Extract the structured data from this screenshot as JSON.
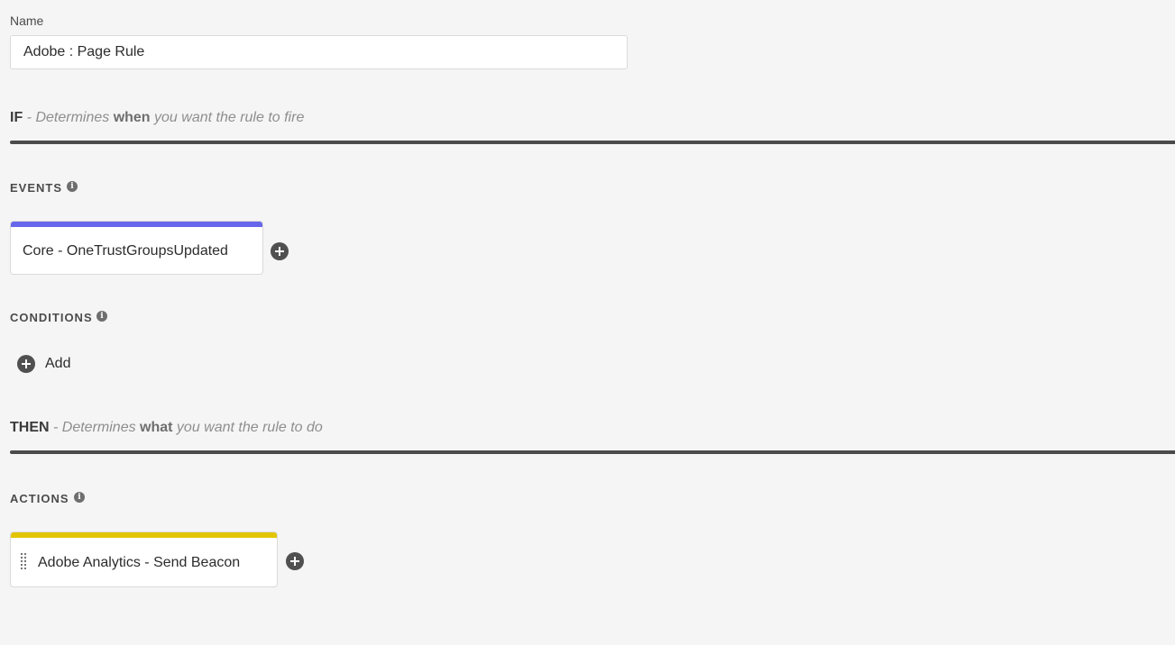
{
  "name_field": {
    "label": "Name",
    "value": "Adobe : Page Rule"
  },
  "if_section": {
    "keyword": "IF",
    "desc_prefix": " - Determines ",
    "desc_strong": "when",
    "desc_suffix": " you want the rule to fire"
  },
  "events": {
    "label": "EVENTS",
    "items": [
      {
        "label": "Core - OneTrustGroupsUpdated",
        "accent": "#6767ec"
      }
    ]
  },
  "conditions": {
    "label": "CONDITIONS",
    "add_label": "Add"
  },
  "then_section": {
    "keyword": "THEN",
    "desc_prefix": " - Determines ",
    "desc_strong": "what",
    "desc_suffix": " you want the rule to do"
  },
  "actions": {
    "label": "ACTIONS",
    "items": [
      {
        "label": "Adobe Analytics - Send Beacon",
        "accent": "#e2c500"
      }
    ]
  },
  "icons": {
    "info": "info-icon",
    "add": "plus-circle-icon",
    "drag": "drag-handle-icon"
  }
}
